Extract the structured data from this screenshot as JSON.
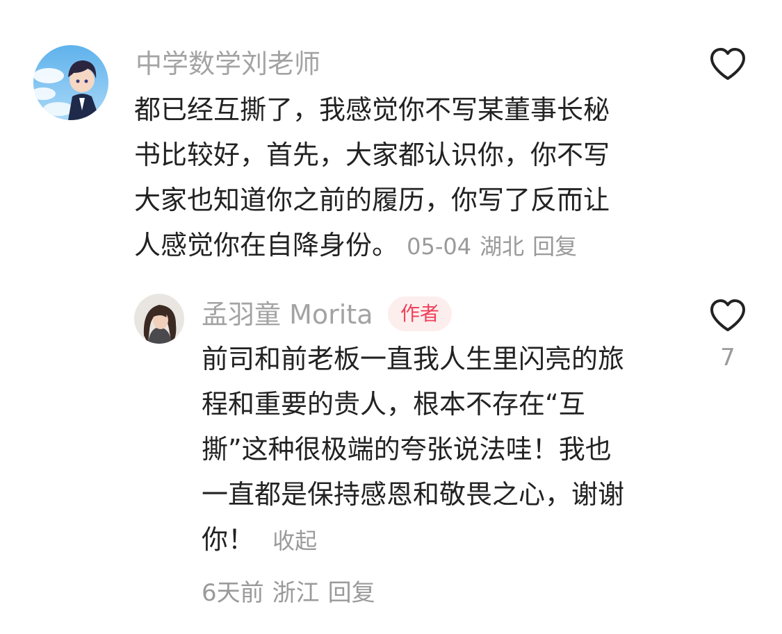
{
  "comment": {
    "username": "中学数学刘老师",
    "text_lines": [
      "都已经互撕了，我感觉你不写某董事长秘",
      "书比较好，首先，大家都认识你，你不写",
      "大家也知道你之前的履历，你写了反而让",
      "人感觉你在自降身份。"
    ],
    "date": "05-04",
    "location": "湖北",
    "reply_label": "回复"
  },
  "reply": {
    "username": "孟羽童 Morita",
    "badge": "作者",
    "text_lines": [
      "前司和前老板一直我人生里闪亮的旅",
      "程和重要的贵人，根本不存在“互",
      "撕”这种很极端的夸张说法哇！我也",
      "一直都是保持感恩和敬畏之心，谢谢",
      "你！"
    ],
    "collapse_label": "收起",
    "date": "6天前",
    "location": "浙江",
    "reply_label": "回复",
    "like_count": "7"
  },
  "colors": {
    "username": "#a3a3a3",
    "text": "#222222",
    "meta": "#9a9a9a",
    "badge_text": "#f0405a",
    "badge_bg": "#fdeeee"
  }
}
